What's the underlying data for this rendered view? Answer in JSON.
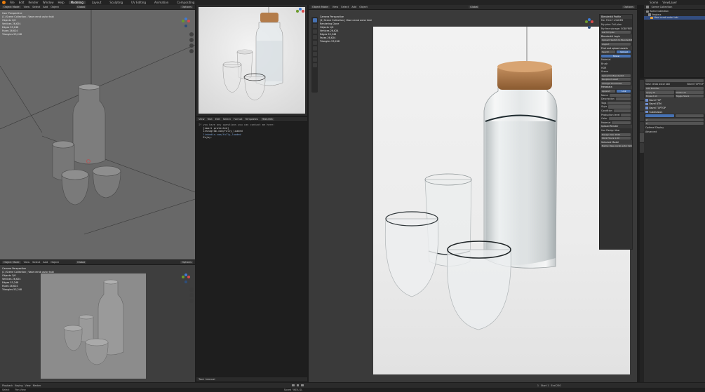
{
  "topbar": {
    "menus": [
      "File",
      "Edit",
      "Render",
      "Window",
      "Help"
    ],
    "workspaces": [
      "Modeling",
      "Layout",
      "Sculpting",
      "UV Editing",
      "Animation",
      "Compositing"
    ],
    "active_workspace": "Modeling",
    "scene": "Scene",
    "view_layer": "ViewLayer"
  },
  "viewport_tl": {
    "mode": "Object Mode",
    "menus": [
      "View",
      "Select",
      "Add",
      "Object"
    ],
    "transform": "Global",
    "options": "Options",
    "view_name": "User Perspective",
    "collection": "(1) Scene Collection | Vase cerab autor tabi",
    "stats": [
      {
        "k": "Objects",
        "v": "1/6"
      },
      {
        "k": "Vertices",
        "v": "26,624"
      },
      {
        "k": "Edges",
        "v": "53,248"
      },
      {
        "k": "Faces",
        "v": "26,624"
      },
      {
        "k": "Triangles",
        "v": "53,248"
      }
    ]
  },
  "viewport_bl": {
    "mode": "Object Mode",
    "menus": [
      "View",
      "Select",
      "Add",
      "Object"
    ],
    "transform": "Global",
    "options": "Options",
    "view_name": "Camera Perspective",
    "collection": "(1) Scene Collection | Vase cerab autor tabi",
    "stats": [
      {
        "k": "Objects",
        "v": "1/6"
      },
      {
        "k": "Vertices",
        "v": "26,624"
      },
      {
        "k": "Edges",
        "v": "53,248"
      },
      {
        "k": "Faces",
        "v": "26,624"
      },
      {
        "k": "Triangles",
        "v": "53,248"
      }
    ]
  },
  "text_editor": {
    "menus": [
      "View",
      "Text",
      "Edit",
      "Select",
      "Format",
      "Templates"
    ],
    "file": "Text.001",
    "lines": [
      "If you have any questions you can contact me here:",
      "",
      "   [email protected]",
      "   instagram.com/fully_loaded",
      "   linkedin.com/fully_loaded",
      "",
      "",
      "   Enjoy."
    ],
    "status": "Text: Internal"
  },
  "viewport_main": {
    "mode": "Object Mode",
    "menus": [
      "View",
      "Select",
      "Add",
      "Object"
    ],
    "transform": "Global",
    "options": "Options",
    "view_name": "Camera Perspective",
    "collection": "(1) Scene Collection | Vase cerab autor tabi",
    "sub": "Rendering Done",
    "stats": [
      {
        "k": "Objects",
        "v": "1/6"
      },
      {
        "k": "Vertices",
        "v": "26,624"
      },
      {
        "k": "Edges",
        "v": "53,248"
      },
      {
        "k": "Faces",
        "v": "26,624"
      },
      {
        "k": "Triangles",
        "v": "53,248"
      }
    ]
  },
  "addon_panel": {
    "sections": [
      {
        "title": "Blenderkit Profile",
        "rows": [
          "Me: FULLY LOADED",
          "My plan: Full plan",
          "My free storage: 5GB FREE",
          "Get full plan"
        ]
      },
      {
        "title": "Blenderkit Login",
        "rows": [
          "Upload: Switch to BlenderKit",
          "Logout"
        ]
      },
      {
        "title": "Find and upload assets",
        "rows": [
          "Search",
          "Upload"
        ]
      },
      {
        "title": "Asset type",
        "rows": [
          "Model",
          "Material",
          "Brush",
          "HDR",
          "Scene"
        ]
      },
      {
        "title": "Upload",
        "rows": [
          "Upload to BlenderKit",
          "Reupload asset",
          "Change Thumbnail",
          "Metadata"
        ]
      },
      {
        "title": "Import method",
        "rows": [
          "Append",
          "Link"
        ]
      },
      {
        "title": "Details",
        "rows": [
          "Name",
          "Description",
          "Tags",
          "Style",
          "Condition",
          "Production level",
          "Color",
          "Material"
        ]
      },
      {
        "title": "Upload Render",
        "rows": [
          "Use Design Year",
          "Design Year 2022",
          "Work Hours 1.00"
        ]
      },
      {
        "title": "Selected Model",
        "rows": [
          "Name: Vase cerab autor tabi"
        ]
      }
    ]
  },
  "outliner": {
    "title": "Scene Collection",
    "rows": [
      "Scene Collection",
      "Ikaglass",
      "Vase cerab autor tabi"
    ]
  },
  "properties": {
    "object": "Vase cerab autor tabi",
    "modifier": "Bevel TOPTOP",
    "rows": [
      "Add Modifier",
      "Apply All",
      "Delete All",
      "Expand All",
      "Toggle Stack",
      "Bevel TOP",
      "Bevel BTM",
      "Bevel TOPTOP",
      "Subdivision"
    ],
    "levels_viewport": "2",
    "render": "2",
    "optimal_display": "Optimal Display",
    "advanced": "Advanced"
  },
  "timeline": {
    "playback": "Playback",
    "keying": "Keying",
    "view": "View",
    "marker": "Marker",
    "start": "Start 1",
    "end": "End 250",
    "frame": "1"
  },
  "statusbar": {
    "left": "Select",
    "middle": "Pan View",
    "right": "Saved \"IKEA GL"
  }
}
